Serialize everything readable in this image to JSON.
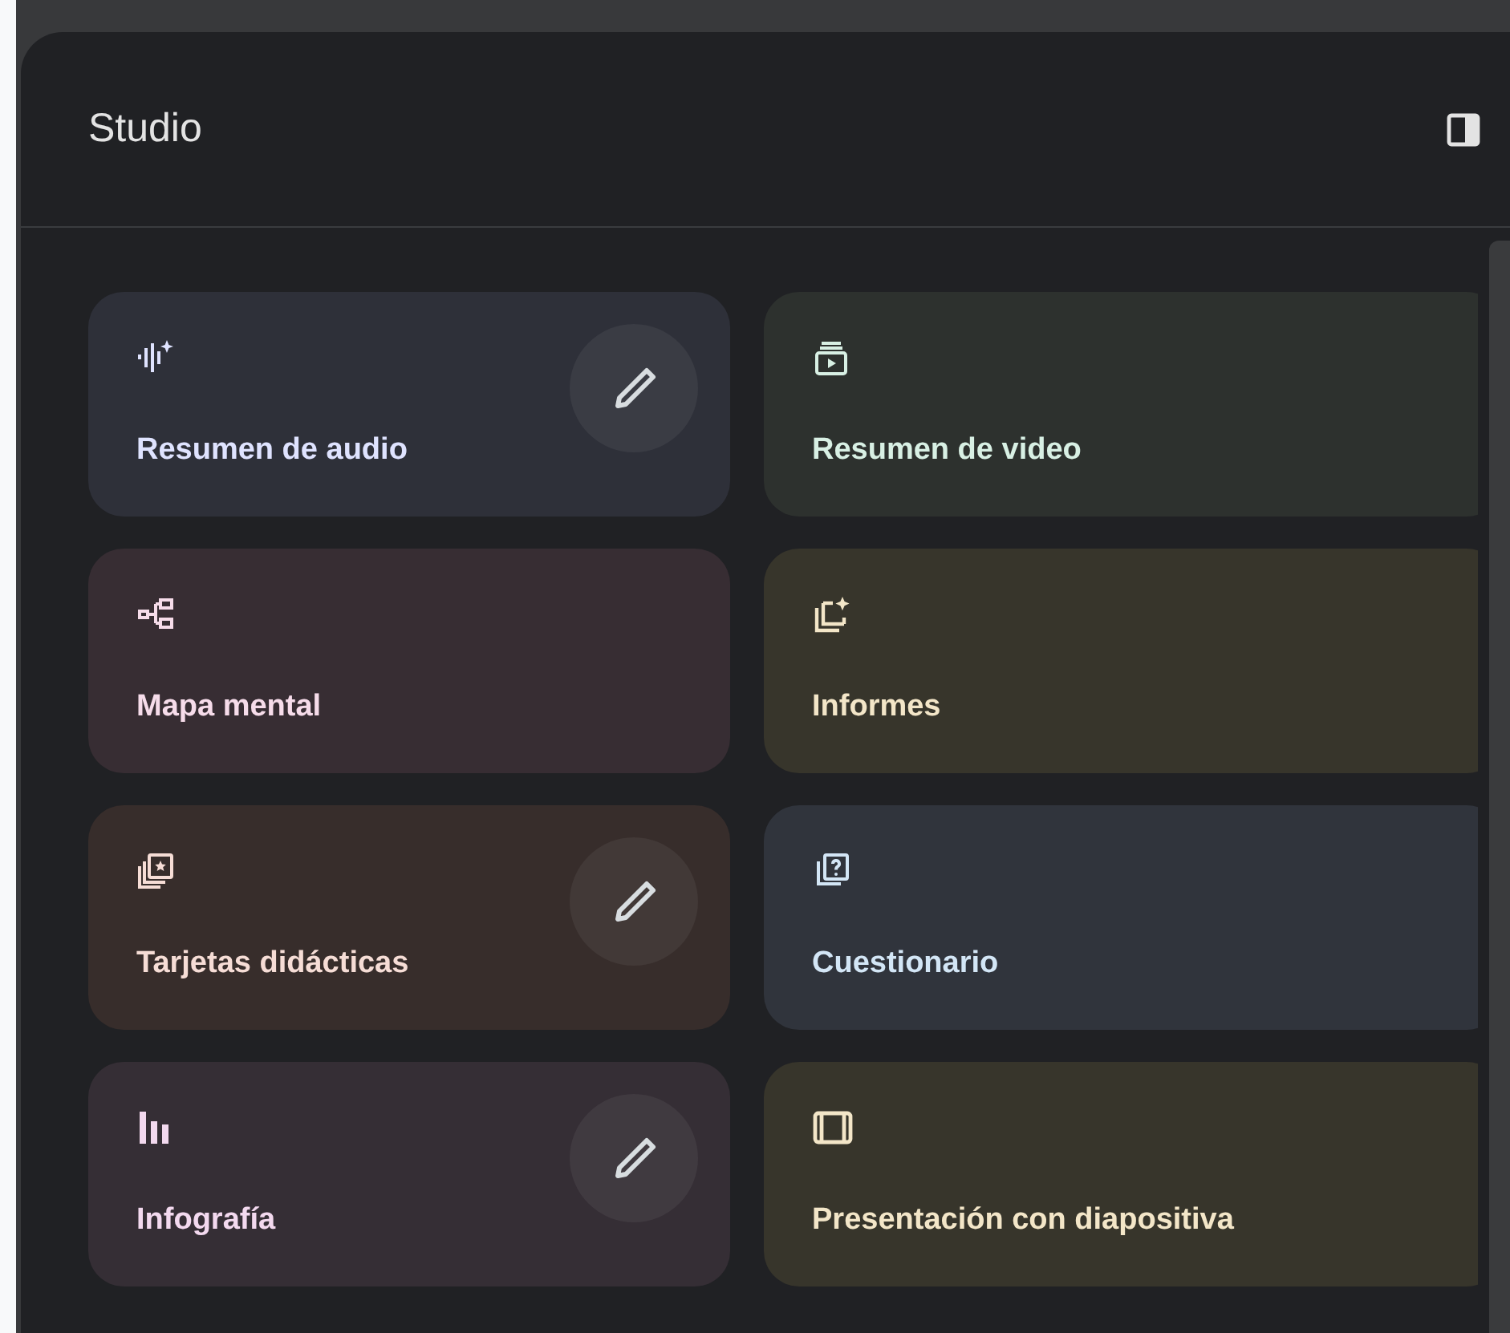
{
  "panel": {
    "title": "Studio"
  },
  "cards": [
    {
      "label": "Resumen de audio",
      "color": "#2e3039",
      "edit_button": true
    },
    {
      "label": "Resumen de video",
      "color": "#2d312e",
      "edit_button": false
    },
    {
      "label": "Mapa mental",
      "color": "#372d33",
      "edit_button": false
    },
    {
      "label": "Informes",
      "color": "#37352b",
      "edit_button": false
    },
    {
      "label": "Tarjetas didácticas",
      "color": "#372d2b",
      "edit_button": true
    },
    {
      "label": "Cuestionario",
      "color": "#30343c",
      "edit_button": false
    },
    {
      "label": "Infografía",
      "color": "#352e35",
      "edit_button": true
    },
    {
      "label": "Presentación con diapositiva",
      "color": "#37352b",
      "edit_button": false
    }
  ]
}
